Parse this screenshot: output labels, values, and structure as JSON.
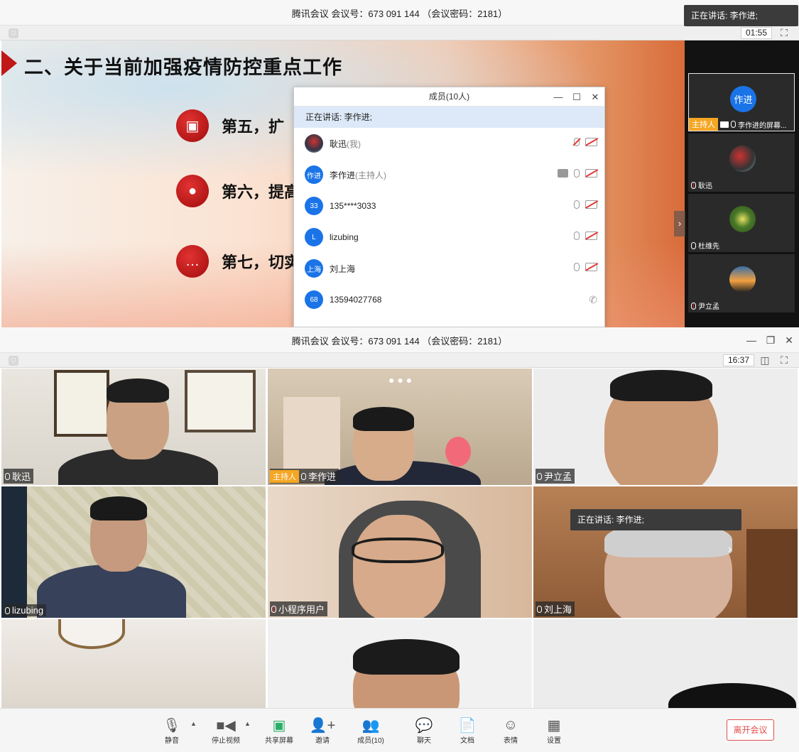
{
  "top_window": {
    "title": "腾讯会议 会议号：673 091 144 （会议密码：2181）",
    "timer": "01:55",
    "speaking_toast": "正在讲话: 李作进;",
    "slide": {
      "title": "二、关于当前加强疫情防控重点工作",
      "bullets": [
        "第五，扩",
        "第六，提高",
        "第七，切实"
      ]
    },
    "sidebar": {
      "tiles": [
        {
          "avatar_text": "作进",
          "host_tag": "主持人",
          "label": "李作进的屏幕..."
        },
        {
          "label": "耿迅"
        },
        {
          "label": "杜维先"
        },
        {
          "label": "尹立孟"
        }
      ]
    },
    "members_panel": {
      "title": "成员(10人)",
      "speaking": "正在讲话: 李作进;",
      "rows": [
        {
          "avatar": "",
          "name": "耿迅",
          "role": "(我)"
        },
        {
          "avatar": "作进",
          "name": "李作进",
          "role": "(主持人)"
        },
        {
          "avatar": "33",
          "name": "135****3033",
          "role": ""
        },
        {
          "avatar": "L",
          "name": "lizubing",
          "role": ""
        },
        {
          "avatar": "上海",
          "name": "刘上海",
          "role": ""
        },
        {
          "avatar": "68",
          "name": "13594027768",
          "role": ""
        }
      ]
    }
  },
  "bottom_window": {
    "title": "腾讯会议 会议号：673 091 144 （会议密码：2181）",
    "timer": "16:37",
    "speaking_toast": "正在讲话: 李作进;",
    "tiles": [
      {
        "name": "耿迅"
      },
      {
        "name": "李作进",
        "host_tag": "主持人"
      },
      {
        "name": "尹立孟"
      },
      {
        "name": "lizubing"
      },
      {
        "name": "小程序用户"
      },
      {
        "name": "刘上海"
      },
      {
        "name": ""
      },
      {
        "name": ""
      },
      {
        "name": ""
      }
    ]
  },
  "toolbar": {
    "mute": "静音",
    "stop_video": "停止视频",
    "share_screen": "共享屏幕",
    "invite": "邀请",
    "members": "成员(10)",
    "chat": "聊天",
    "docs": "文档",
    "emoji": "表情",
    "settings": "设置",
    "leave": "离开会议"
  },
  "colors": {
    "accent_blue": "#1a74e8",
    "host_orange": "#f5a623",
    "leave_red": "#e34d4d",
    "share_green": "#2aae67"
  }
}
